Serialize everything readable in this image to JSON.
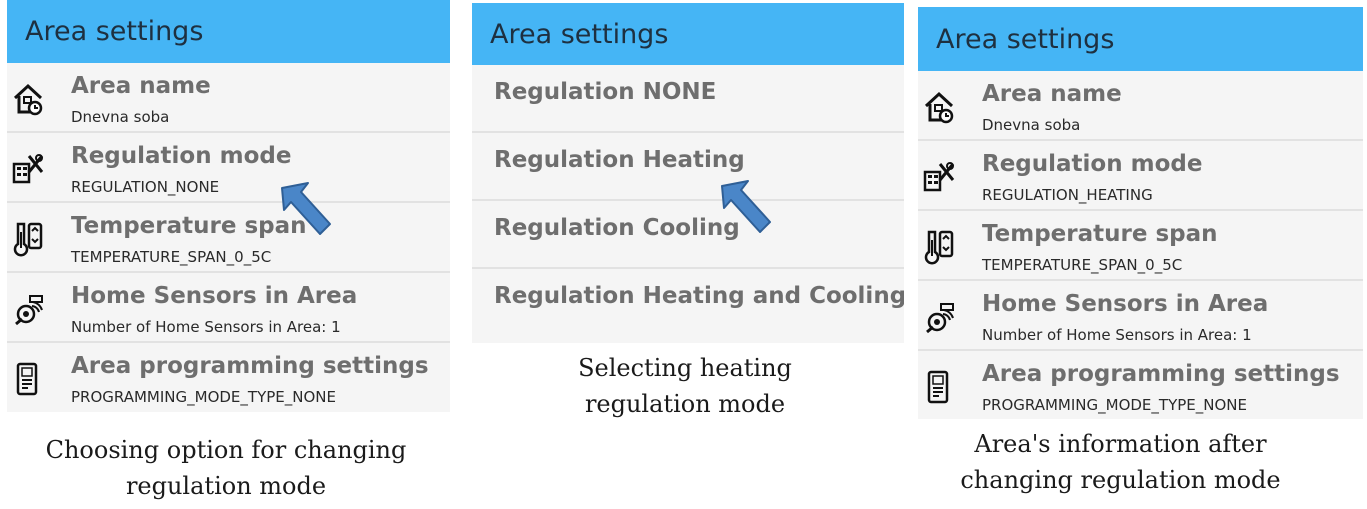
{
  "panels": [
    {
      "header": "Area settings",
      "rows": [
        {
          "icon": "house-clock-icon",
          "title": "Area name",
          "subtitle": "Dnevna soba"
        },
        {
          "icon": "tools-icon",
          "title": "Regulation mode",
          "subtitle": "REGULATION_NONE"
        },
        {
          "icon": "thermometer-icon",
          "title": "Temperature span",
          "subtitle": "TEMPERATURE_SPAN_0_5C"
        },
        {
          "icon": "sensor-icon",
          "title": "Home Sensors in Area",
          "subtitle": "Number of Home Sensors in Area: 1"
        },
        {
          "icon": "programming-icon",
          "title": "Area programming settings",
          "subtitle": "PROGRAMMING_MODE_TYPE_NONE"
        }
      ],
      "caption": [
        "Choosing option for changing",
        "regulation mode"
      ]
    },
    {
      "header": "Area settings",
      "options": [
        "Regulation NONE",
        "Regulation Heating",
        "Regulation Cooling",
        "Regulation Heating and Cooling"
      ],
      "caption": [
        "Selecting heating",
        "regulation mode"
      ]
    },
    {
      "header": "Area settings",
      "rows": [
        {
          "icon": "house-clock-icon",
          "title": "Area name",
          "subtitle": "Dnevna soba"
        },
        {
          "icon": "tools-icon",
          "title": "Regulation mode",
          "subtitle": "REGULATION_HEATING"
        },
        {
          "icon": "thermometer-icon",
          "title": "Temperature span",
          "subtitle": "TEMPERATURE_SPAN_0_5C"
        },
        {
          "icon": "sensor-icon",
          "title": "Home Sensors in Area",
          "subtitle": "Number of Home Sensors in Area: 1"
        },
        {
          "icon": "programming-icon",
          "title": "Area programming settings",
          "subtitle": "PROGRAMMING_MODE_TYPE_NONE"
        }
      ],
      "caption": [
        "Area's information after",
        "changing regulation mode"
      ]
    }
  ],
  "colors": {
    "header_bg": "#45b5f5",
    "arrow": "#4a86c8"
  }
}
